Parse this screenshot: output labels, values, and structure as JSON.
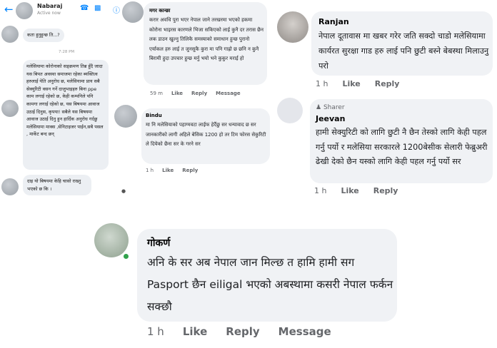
{
  "messenger": {
    "contact_name": "Nabaraj",
    "status": "Active now",
    "back_icon": "back-arrow-icon",
    "header_icons": [
      "phone-icon",
      "video-icon",
      "info-icon"
    ],
    "messages": [
      {
        "text": "कता हुनुहुन्छ ति...?"
      },
      {
        "text": "मलेसियामा कोरोनाको सङ्क्रमण तिब्र हुँदै जादा यस बिपत अवस्था समाजमा रहेका ब्यक्तित्व हरुलाई येति अनुरोध छ, मलेसियामा प्राय सबै सेक्युरिटी वसन गर्ने दाजुभाइहरु बिना ppe काम लगाई रहेको छ, केही कम्पनिले पनि कामगा लगाई रहेको छ, यस बिषयमा आवाज उठाई दिनुस, कृपया! सबैले यस बिषयमा आवाज उठाई दिनु हुन हार्दिक अनुरोध गर्दछु मलेसियामा माक्स ,सेनिटाइजर पाईन,सबै पसल , मार्केट बन्द छन्"
      },
      {
        "text": "दाइ यो बिषयमा केहि चासो राख्नु भएको छ कि ।"
      }
    ],
    "time_divider": "7:28 PM"
  },
  "magar": {
    "name": "मगर कान्छा",
    "text": "करार अवधि पुरा भएर नेपाल जाने तरखरमा भएको हकमा कोरोना भाइरस कारणले भिजा सकिएको लाई कुनै दर तरास छैन लक डाउन खुल्नु तिलिकै समस्याको समाधान हुन्छ पुरानो एर्याकल हरु लाई त जुनसुकै कुरा मा पनि गाह्रो छ छनि न कुनै बिरामी हुदा उपचार हुन्छ मर्नु भयो भने कुकुर मराई हो",
    "time": "59 m",
    "actions": [
      "Like",
      "Reply",
      "Message"
    ]
  },
  "bindu": {
    "name": "Bindu",
    "text": "मा नि मलेसियाको पहाग्मवटा लाईफ हेर्दैछु सर धन्यावाद छ सर जानकारीको लागी अहिले बेसिक 1200 हो तर टिम फोरस सेकुरिटी ले दियेको छैना सर के गरने सर",
    "time": "1 h",
    "actions": [
      "Like",
      "Reply"
    ]
  },
  "ranjan": {
    "name": "Ranjan",
    "text": "नेपाल दूतावास मा खबर गरेर जति सक्दो चाडो मलेसियामा कार्यरत सुरक्षा गाड हरु लाई पनि छुटी बस्ने बेबस्था मिलाउनु परो",
    "time": "1 h",
    "actions": [
      "Like",
      "Reply"
    ]
  },
  "jeevan": {
    "badge": "Sharer",
    "name": "Jeevan",
    "text": "हामी सेक्युरिटी को लागि छुटी नै छैन तेस्को लागि केही पहल गर्नु पर्यो र मलेसिया सरकारले 1200बेसीक सेलारी फेब्रुअरी ढेखी देको छैन यस्को लागि केही पहल गर्नु पर्यो सर",
    "time": "1 h",
    "actions": [
      "Like",
      "Reply"
    ]
  },
  "gokarna": {
    "name": "गोकर्ण",
    "text": "अनि के सर अब नेपाल जान मिल्छ त हामि हामी सग Pasport छैन eiligal भएको अबस्थामा कसरी नेपाल फर्कन सक्छौ",
    "time": "1 h",
    "actions": [
      "Like",
      "Reply",
      "Message"
    ]
  },
  "colors": {
    "messenger_blue": "#0084ff",
    "bubble": "#f0f2f5",
    "meta": "#65676b"
  }
}
